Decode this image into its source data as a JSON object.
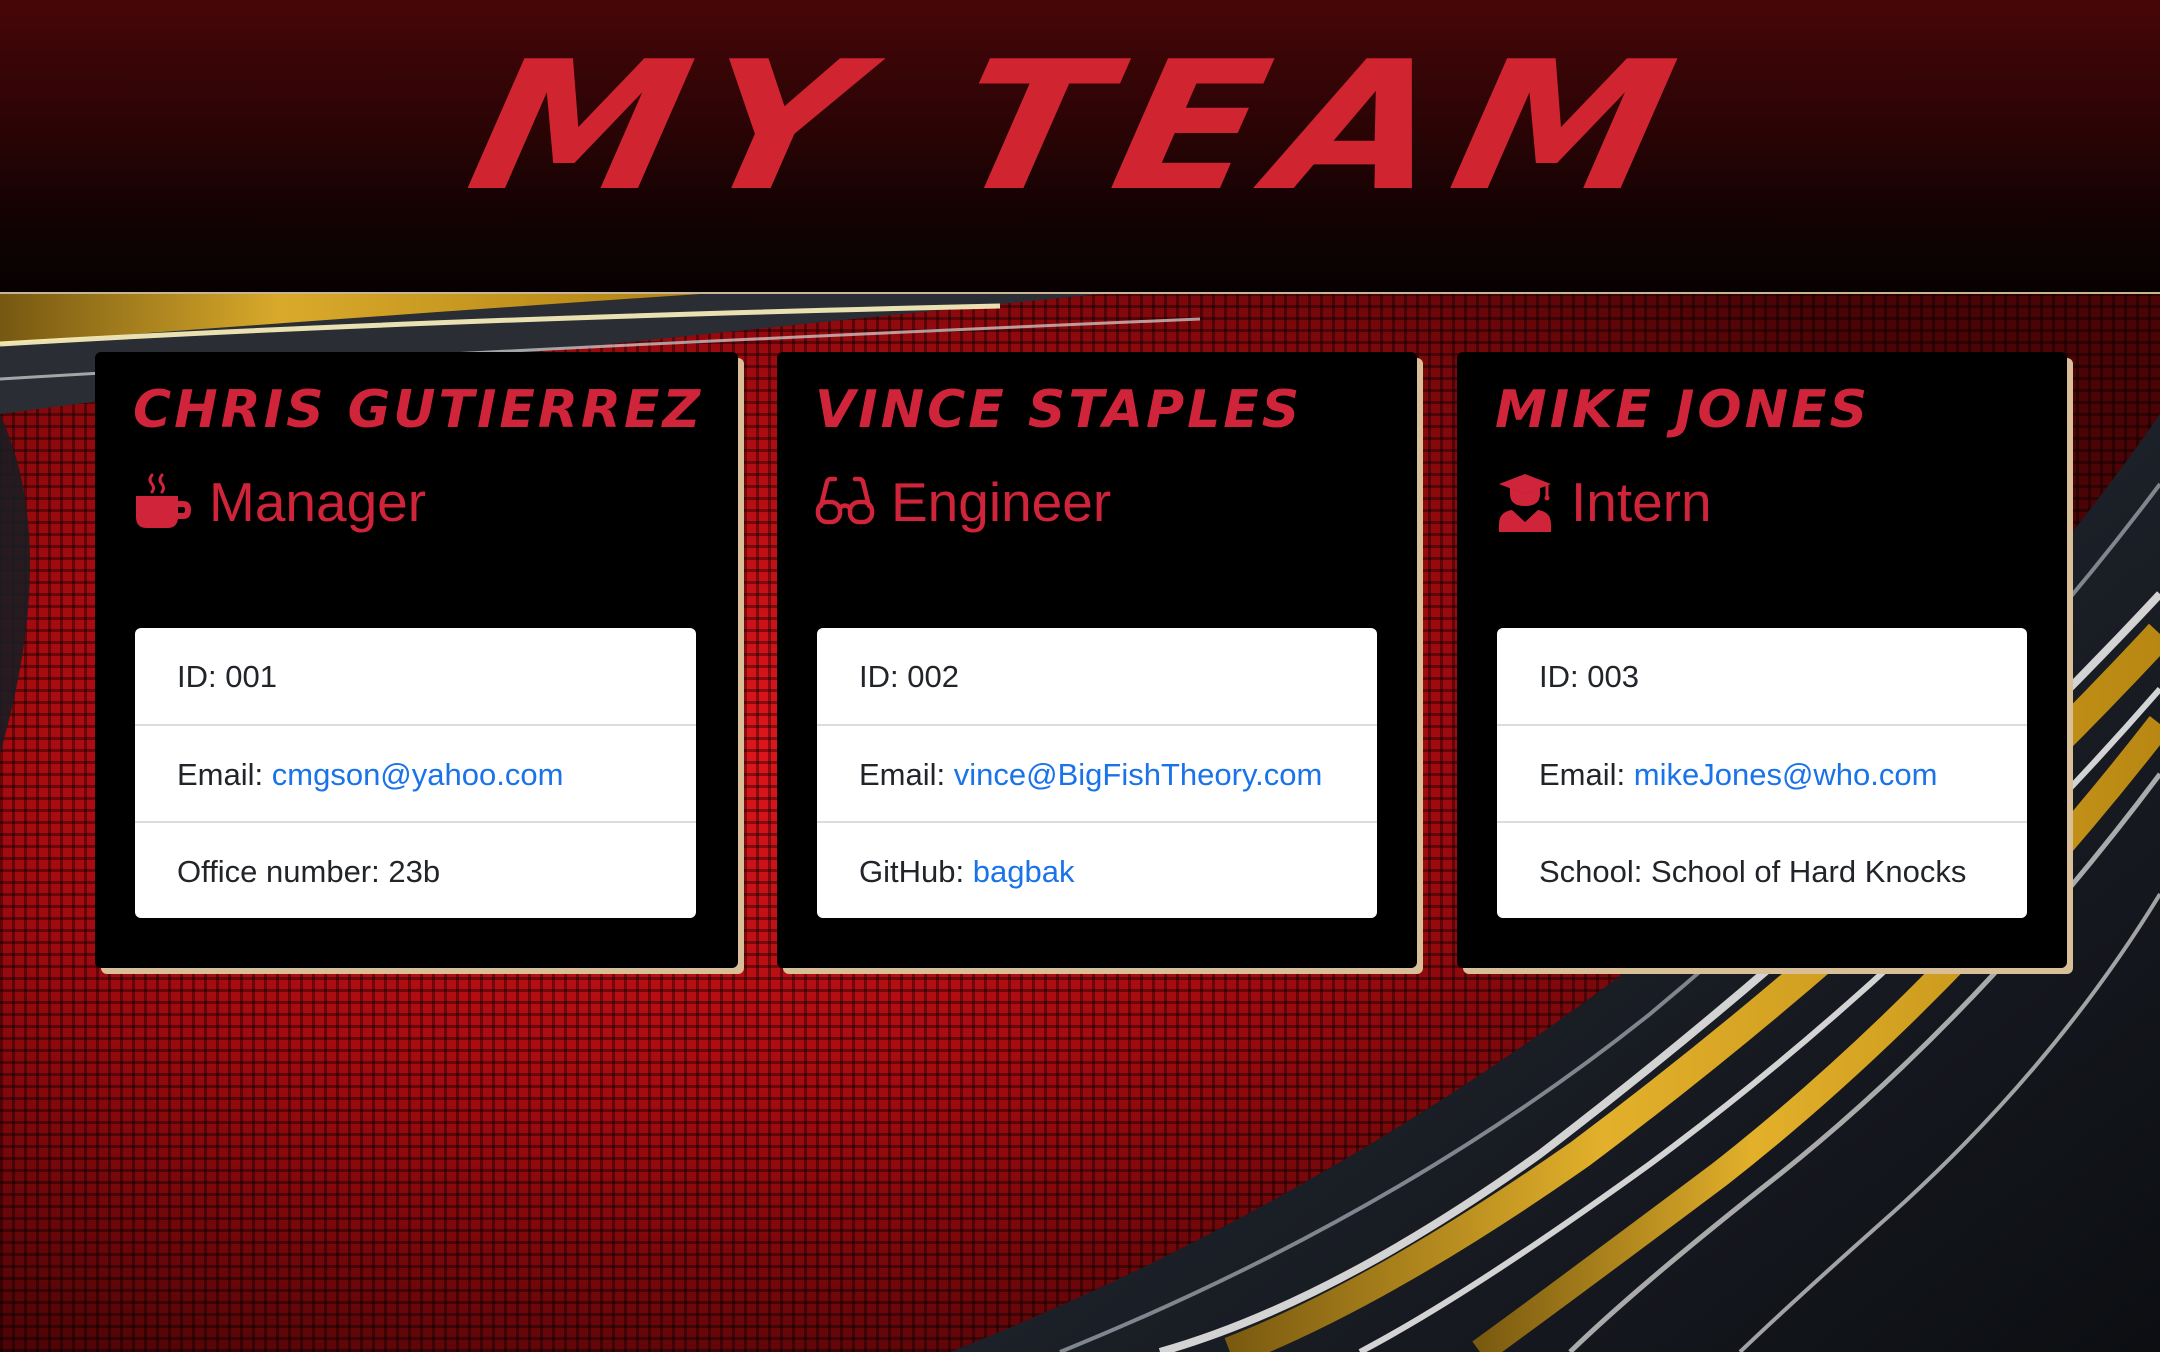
{
  "header": {
    "title": "MY TEAM"
  },
  "colors": {
    "accent": "#d0243a",
    "link": "#1a73e8",
    "card_bg": "#000000",
    "card_shadow": "#d8bf98"
  },
  "team": [
    {
      "name": "Chris Gutierrez",
      "role": "Manager",
      "role_icon": "coffee-mug-icon",
      "id_label": "ID:",
      "id": "001",
      "email_label": "Email:",
      "email": "cmgson@yahoo.com",
      "extra_label": "Office number:",
      "extra": "23b"
    },
    {
      "name": "Vince Staples",
      "role": "Engineer",
      "role_icon": "glasses-icon",
      "id_label": "ID:",
      "id": "002",
      "email_label": "Email:",
      "email": "vince@BigFishTheory.com",
      "extra_label": "GitHub:",
      "extra": "bagbak"
    },
    {
      "name": "Mike Jones",
      "role": "Intern",
      "role_icon": "graduate-icon",
      "id_label": "ID:",
      "id": "003",
      "email_label": "Email:",
      "email": "mikeJones@who.com",
      "extra_label": "School:",
      "extra": "School of Hard Knocks"
    }
  ]
}
